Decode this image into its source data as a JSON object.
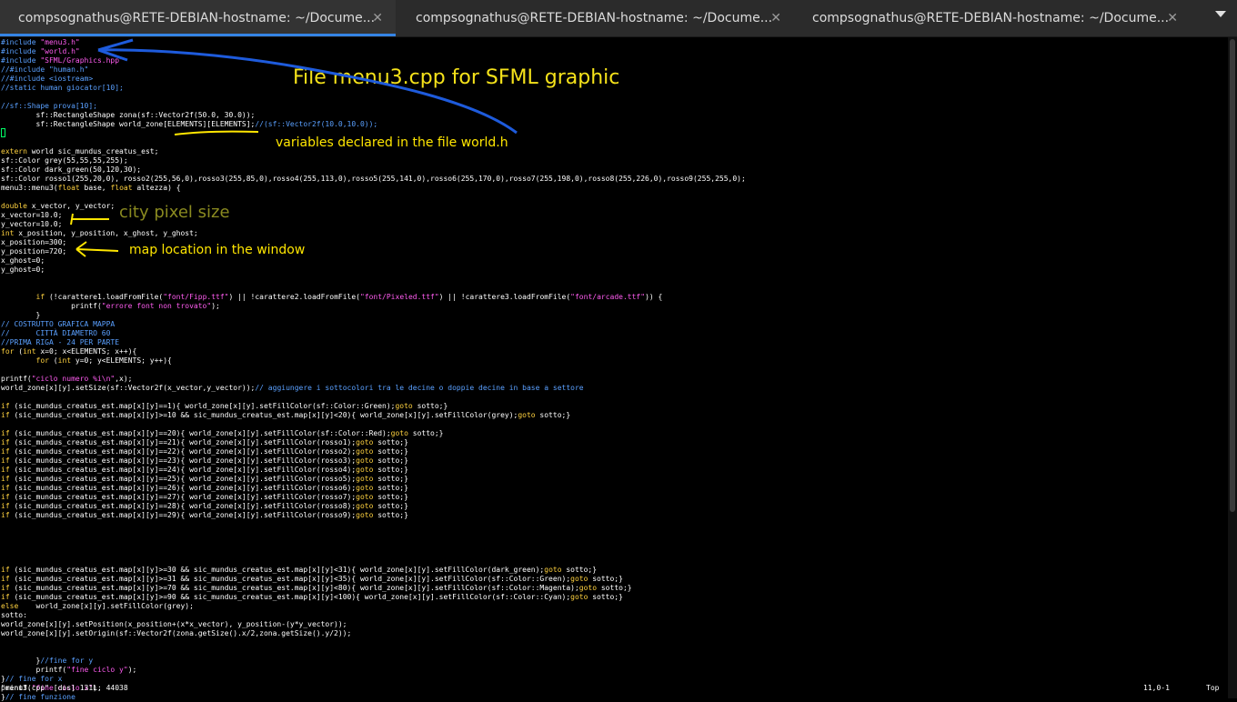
{
  "tabs": [
    {
      "label": "compsognathus@RETE-DEBIAN-hostname: ~/Docume...",
      "close": "✕",
      "active": true
    },
    {
      "label": "compsognathus@RETE-DEBIAN-hostname: ~/Docume...",
      "close": "✕",
      "active": false
    },
    {
      "label": "compsognathus@RETE-DEBIAN-hostname: ~/Docume...",
      "close": "✕",
      "active": false
    }
  ],
  "code_lines": [
    "#include \"menu3.h\"",
    "#include \"world.h\"",
    "#include \"SFML/Graphics.hpp\"",
    "//#include \"human.h\"",
    "//#include <iostream>",
    "//static human giocator[10];",
    "",
    "//sf::Shape prova[10];",
    "        sf::RectangleShape zona(sf::Vector2f(50.0, 30.0));",
    "        sf::RectangleShape world_zone[ELEMENTS][ELEMENTS];//(sf::Vector2f(10.0,10.0));",
    "",
    "",
    "extern world sic_mundus_creatus_est;",
    "sf::Color grey(55,55,55,255);",
    "sf::Color dark_green(50,120,30);",
    "sf::Color rosso1(255,20,0), rosso2(255,56,0),rosso3(255,85,0),rosso4(255,113,0),rosso5(255,141,0),rosso6(255,170,0),rosso7(255,198,0),rosso8(255,226,0),rosso9(255,255,0);",
    "menu3::menu3(float base, float altezza) {",
    "",
    "double x_vector, y_vector;",
    "x_vector=10.0;",
    "y_vector=10.0;",
    "int x_position, y_position, x_ghost, y_ghost;",
    "x_position=300;",
    "y_position=720;",
    "x_ghost=0;",
    "y_ghost=0;",
    "",
    "",
    "        if (!carattere1.loadFromFile(\"font/Fipp.ttf\") || !carattere2.loadFromFile(\"font/Pixeled.ttf\") || !carattere3.loadFromFile(\"font/arcade.ttf\")) {",
    "                printf(\"errore font non trovato\");",
    "        }",
    "// COSTRUTTO GRAFICA MAPPA",
    "//      CITTÀ DIAMETRO 60",
    "//PRIMA RIGA - 24 PER PARTE",
    "for (int x=0; x<ELEMENTS; x++){",
    "        for (int y=0; y<ELEMENTS; y++){",
    "",
    "printf(\"ciclo numero %i\\n\",x);",
    "world_zone[x][y].setSize(sf::Vector2f(x_vector,y_vector));// aggiungere i sottocolori tra le decine o doppie decine in base a settore",
    "",
    "if (sic_mundus_creatus_est.map[x][y]==1){ world_zone[x][y].setFillColor(sf::Color::Green);goto sotto;}",
    "if (sic_mundus_creatus_est.map[x][y]>=10 && sic_mundus_creatus_est.map[x][y]<20){ world_zone[x][y].setFillColor(grey);goto sotto;}",
    "",
    "if (sic_mundus_creatus_est.map[x][y]==20){ world_zone[x][y].setFillColor(sf::Color::Red);goto sotto;}",
    "if (sic_mundus_creatus_est.map[x][y]==21){ world_zone[x][y].setFillColor(rosso1);goto sotto;}",
    "if (sic_mundus_creatus_est.map[x][y]==22){ world_zone[x][y].setFillColor(rosso2);goto sotto;}",
    "if (sic_mundus_creatus_est.map[x][y]==23){ world_zone[x][y].setFillColor(rosso3);goto sotto;}",
    "if (sic_mundus_creatus_est.map[x][y]==24){ world_zone[x][y].setFillColor(rosso4);goto sotto;}",
    "if (sic_mundus_creatus_est.map[x][y]==25){ world_zone[x][y].setFillColor(rosso5);goto sotto;}",
    "if (sic_mundus_creatus_est.map[x][y]==26){ world_zone[x][y].setFillColor(rosso6);goto sotto;}",
    "if (sic_mundus_creatus_est.map[x][y]==27){ world_zone[x][y].setFillColor(rosso7);goto sotto;}",
    "if (sic_mundus_creatus_est.map[x][y]==28){ world_zone[x][y].setFillColor(rosso8);goto sotto;}",
    "if (sic_mundus_creatus_est.map[x][y]==29){ world_zone[x][y].setFillColor(rosso9);goto sotto;}",
    "",
    "",
    "",
    "",
    "",
    "if (sic_mundus_creatus_est.map[x][y]>=30 && sic_mundus_creatus_est.map[x][y]<31){ world_zone[x][y].setFillColor(dark_green);goto sotto;}",
    "if (sic_mundus_creatus_est.map[x][y]>=31 && sic_mundus_creatus_est.map[x][y]<35){ world_zone[x][y].setFillColor(sf::Color::Green);goto sotto;}",
    "if (sic_mundus_creatus_est.map[x][y]>=70 && sic_mundus_creatus_est.map[x][y]<80){ world_zone[x][y].setFillColor(sf::Color::Magenta);goto sotto;}",
    "if (sic_mundus_creatus_est.map[x][y]>=90 && sic_mundus_creatus_est.map[x][y]<100){ world_zone[x][y].setFillColor(sf::Color::Cyan);goto sotto;}",
    "else    world_zone[x][y].setFillColor(grey);",
    "sotto:",
    "world_zone[x][y].setPosition(x_position+(x*x_vector), y_position-(y*y_vector));",
    "world_zone[x][y].setOrigin(sf::Vector2f(zona.getSize().x/2,zona.getSize().y/2));",
    "",
    "",
    "        }//fine for y",
    "        printf(\"fine ciclo y\");",
    "}// fine for x",
    "printf(\"fine ciclo x\");",
    "}// fine funzione"
  ],
  "status": {
    "file": "\"menu3.cpp\" [dos] 131L, 44038",
    "position": "11,0-1",
    "scroll": "Top"
  },
  "annotations": {
    "title": "File menu3.cpp for SFML graphic",
    "variables": "variables declared in the file world.h",
    "city_size": "city pixel size",
    "map_location": "map location in the window"
  },
  "colors": {
    "title": "#f5e21a",
    "annotation_yellow": "#ffe600",
    "city_size": "#8a8a20",
    "arrow_blue": "#1e5bdc",
    "tab_underline": "#3584e4"
  }
}
